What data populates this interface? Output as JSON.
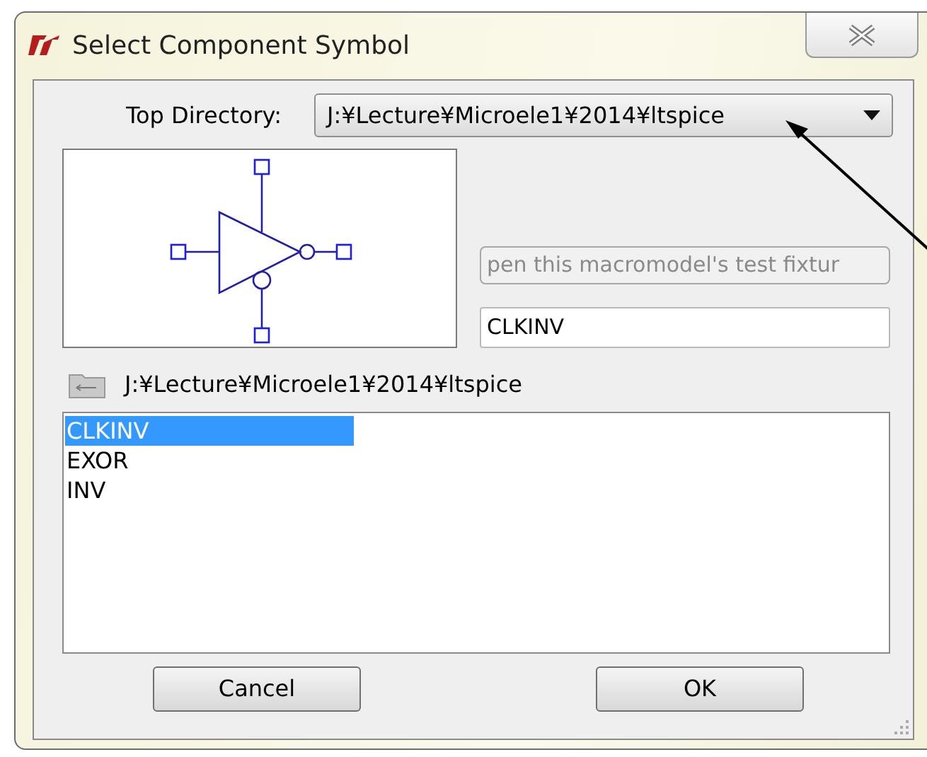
{
  "window": {
    "title": "Select Component Symbol"
  },
  "top_directory": {
    "label": "Top Directory:",
    "value": "J:¥Lecture¥Microele1¥2014¥ltspice"
  },
  "description": {
    "value": "pen this macromodel's test fixtur",
    "disabled": true
  },
  "symbol_name": {
    "value": "CLKINV"
  },
  "current_path": "J:¥Lecture¥Microele1¥2014¥ltspice",
  "symbols": [
    {
      "label": "CLKINV",
      "selected": true
    },
    {
      "label": "EXOR",
      "selected": false
    },
    {
      "label": "INV",
      "selected": false
    }
  ],
  "buttons": [
    {
      "label": "Cancel"
    },
    {
      "label": "OK"
    }
  ]
}
